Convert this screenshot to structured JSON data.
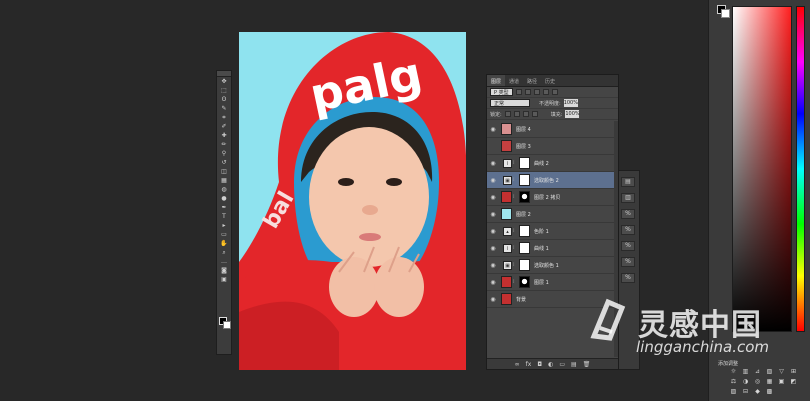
{
  "tools": {
    "icons": [
      "move",
      "marquee",
      "lasso",
      "quick-select",
      "crop",
      "eyedropper",
      "heal",
      "brush",
      "stamp",
      "history-brush",
      "eraser",
      "gradient",
      "blur",
      "dodge",
      "pen",
      "type",
      "path-select",
      "shape",
      "hand",
      "zoom",
      "more",
      "quick-mask",
      "screen-mode"
    ],
    "glyphs": [
      "✥",
      "⬚",
      "ʘ",
      "✎",
      "⌗",
      "✐",
      "✚",
      "✏",
      "⚲",
      "↺",
      "◫",
      "▦",
      "◍",
      "●",
      "✒",
      "T",
      "▸",
      "▭",
      "✋",
      "⌕",
      "…",
      "◙",
      "▣"
    ]
  },
  "layers_panel": {
    "tabs": [
      "图层",
      "通道",
      "路径",
      "历史"
    ],
    "filter_kind": "P 类型",
    "blend_mode": "正常",
    "opacity_label": "不透明度:",
    "opacity_value": "100%",
    "lock_label": "锁定:",
    "fill_label": "填充:",
    "fill_value": "100%",
    "layers": [
      {
        "name": "图层 4",
        "visible": true,
        "type": "pixel",
        "thumb": "#d99090",
        "selected": false
      },
      {
        "name": "图层 3",
        "visible": false,
        "type": "pixel",
        "thumb": "#c44040",
        "selected": false
      },
      {
        "name": "曲线 2",
        "visible": true,
        "type": "curves",
        "selected": false
      },
      {
        "name": "选取颜色 2",
        "visible": true,
        "type": "selective",
        "selected": true
      },
      {
        "name": "图层 2 拷贝",
        "visible": true,
        "type": "pixel-mask",
        "thumb": "#c43030",
        "selected": false
      },
      {
        "name": "图层 2",
        "visible": true,
        "type": "pixel",
        "thumb": "#9fe6ee",
        "selected": false
      },
      {
        "name": "色阶 1",
        "visible": true,
        "type": "levels",
        "selected": false
      },
      {
        "name": "曲线 1",
        "visible": true,
        "type": "curves",
        "selected": false
      },
      {
        "name": "选取颜色 1",
        "visible": true,
        "type": "selective",
        "selected": false
      },
      {
        "name": "图层 1",
        "visible": true,
        "type": "pixel-mask",
        "thumb": "#c43030",
        "selected": false
      },
      {
        "name": "背景",
        "visible": true,
        "type": "pixel",
        "thumb": "#c43030",
        "selected": false
      }
    ],
    "bottom_icons": [
      "∞",
      "fx",
      "◘",
      "◐",
      "▭",
      "▤",
      "🗑"
    ]
  },
  "adjustments": {
    "title": "添加调整",
    "icons": [
      "☼",
      "▥",
      "⊿",
      "▧",
      "▽",
      "⊞",
      "⚖",
      "◑",
      "◎",
      "▦",
      "▣",
      "◩",
      "▨",
      "⊟",
      "◆",
      "▩"
    ]
  },
  "canvas": {
    "hood_text": "palg",
    "sleeve_text": "bal"
  },
  "watermark": {
    "brand_cn": "灵感中国",
    "url": "lingganchina.com"
  },
  "colors": {
    "accent_red": "#e3262a",
    "background_cyan": "#8fe3ef",
    "selected_layer": "#5d708f"
  }
}
